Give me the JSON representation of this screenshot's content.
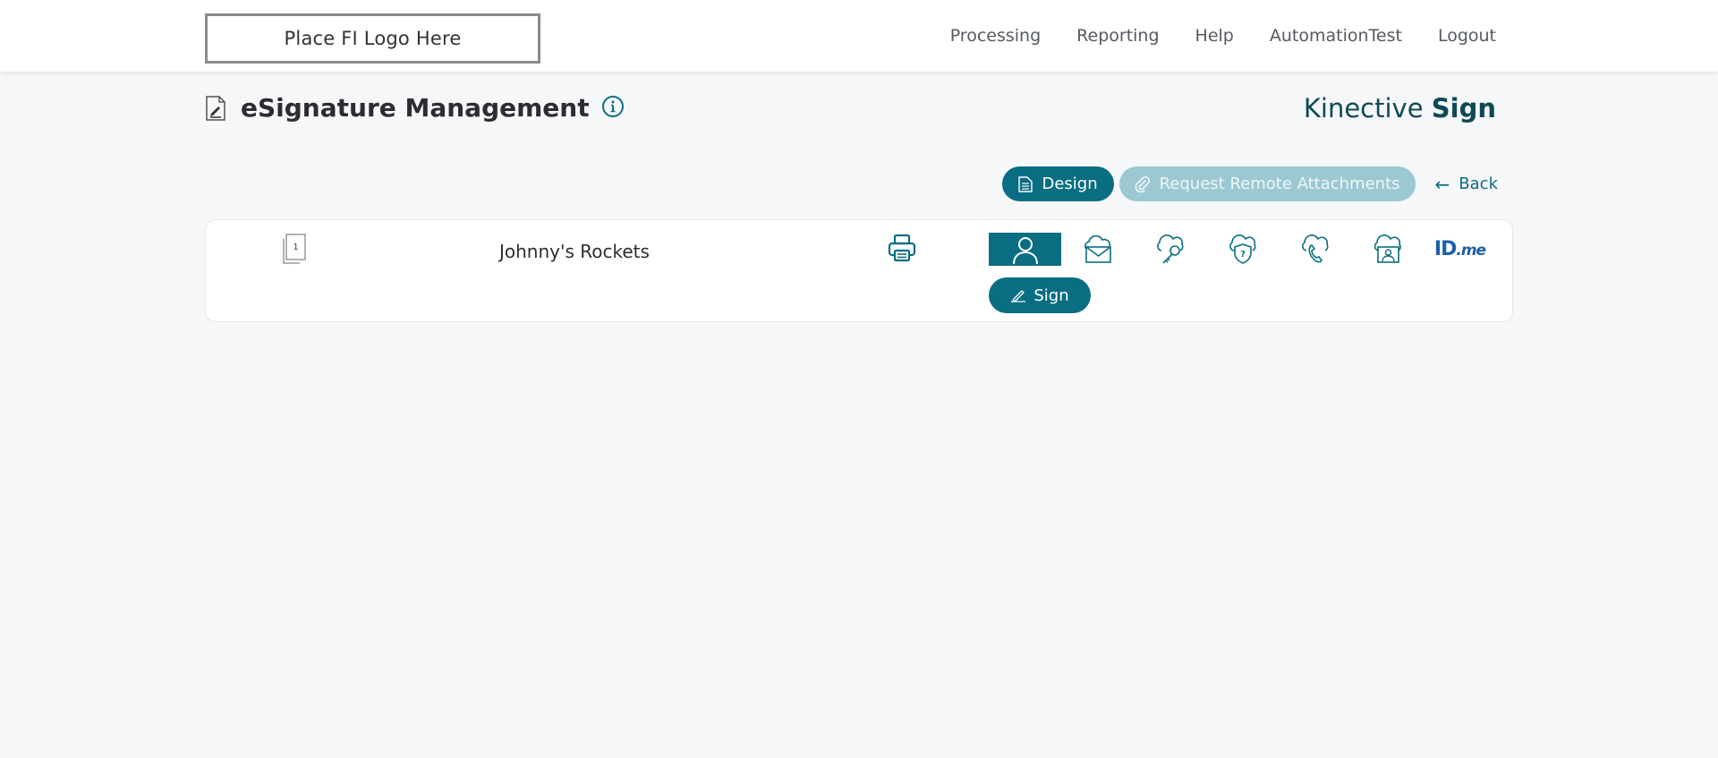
{
  "header": {
    "logo_text": "Place FI Logo Here",
    "nav": [
      "Processing",
      "Reporting",
      "Help",
      "AutomationTest",
      "Logout"
    ]
  },
  "page": {
    "title": "eSignature Management",
    "brand_light": "Kinective ",
    "brand_bold": "Sign"
  },
  "actions": {
    "design_label": "Design",
    "remote_label": "Request Remote Attachments",
    "back_label": "Back",
    "back_arrow": "←"
  },
  "document": {
    "page_count": "1",
    "name": "Johnny's Rockets",
    "sign_label": "Sign",
    "auth_methods": [
      {
        "icon": "person-icon",
        "active": true
      },
      {
        "icon": "cloud-mail-icon",
        "active": false
      },
      {
        "icon": "cloud-key-icon",
        "active": false
      },
      {
        "icon": "cloud-question-icon",
        "active": false
      },
      {
        "icon": "cloud-phone-icon",
        "active": false
      },
      {
        "icon": "cloud-id-icon",
        "active": false
      },
      {
        "icon": "idme-icon",
        "active": false,
        "text_bold": "ID",
        "text_italic": ".me"
      }
    ]
  },
  "colors": {
    "accent": "#0a6e82",
    "accent_disabled": "#9cc8d2",
    "brand_text": "#0f4954",
    "background": "#f5f7f9"
  }
}
